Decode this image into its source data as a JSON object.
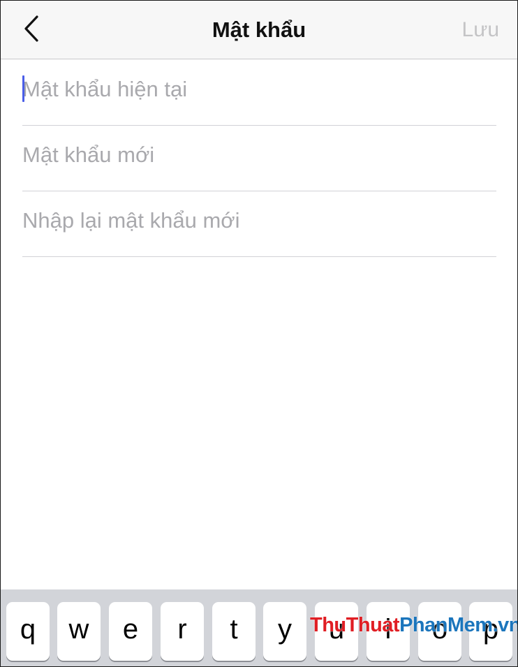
{
  "header": {
    "title": "Mật khẩu",
    "save_label": "Lưu",
    "back_icon": "chevron-left-icon"
  },
  "form": {
    "fields": [
      {
        "placeholder": "Mật khẩu hiện tại",
        "value": ""
      },
      {
        "placeholder": "Mật khẩu mới",
        "value": ""
      },
      {
        "placeholder": "Nhập lại mật khẩu mới",
        "value": ""
      }
    ]
  },
  "keyboard": {
    "keys": [
      "q",
      "w",
      "e",
      "r",
      "t",
      "y",
      "u",
      "i",
      "o",
      "p"
    ]
  },
  "watermark": {
    "part1": "ThuThuat",
    "part2": "PhanMem",
    "part3": ".vn"
  },
  "colors": {
    "caret": "#4a5ee8",
    "save_disabled": "#c4c4c6",
    "placeholder": "#a9a9ad",
    "keyboard_bg": "#d2d4d9",
    "watermark_red": "#e01e24",
    "watermark_blue": "#1b75bc"
  }
}
